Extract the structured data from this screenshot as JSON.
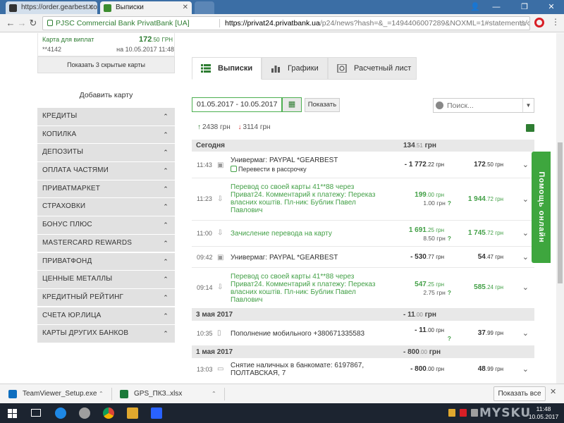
{
  "browser": {
    "tabs": [
      {
        "title": "https://order.gearbest.co"
      },
      {
        "title": "Выписки"
      }
    ],
    "site_identity": "PJSC Commercial Bank PrivatBank [UA]",
    "url_host": "https://privat24.privatbank.ua",
    "url_rest": "/p24/news?hash=&_=1494406007289&NOXML=1#statements/cards/41494"
  },
  "sidebar": {
    "card": {
      "label": "Карта для виплат",
      "amount_main": "172",
      "amount_cents": ".50",
      "currency": "ГРН",
      "number": "**4142",
      "date": "на 10.05.2017 11:48"
    },
    "show_hidden": "Показать 3 скрытые карты",
    "add_card": "Добавить карту",
    "items": [
      {
        "label": "КРЕДИТЫ"
      },
      {
        "label": "КОПИЛКА"
      },
      {
        "label": "ДЕПОЗИТЫ"
      },
      {
        "label": "ОПЛАТА ЧАСТЯМИ"
      },
      {
        "label": "ПРИВАТМАРКЕТ"
      },
      {
        "label": "СТРАХОВКИ"
      },
      {
        "label": "БОНУС ПЛЮС"
      },
      {
        "label": "MASTERCARD REWARDS"
      },
      {
        "label": "ПРИВАТФОНД"
      },
      {
        "label": "ЦЕННЫЕ МЕТАЛЛЫ"
      },
      {
        "label": "КРЕДИТНЫЙ РЕЙТИНГ"
      },
      {
        "label": "СЧЕТА ЮР.ЛИЦА"
      },
      {
        "label": "КАРТЫ ДРУГИХ БАНКОВ"
      }
    ]
  },
  "main": {
    "tabs": [
      {
        "label": "Выписки"
      },
      {
        "label": "Графики"
      },
      {
        "label": "Расчетный лист"
      }
    ],
    "date_range": "01.05.2017 - 10.05.2017",
    "show_button": "Показать",
    "search_placeholder": "Поиск...",
    "income": "2438 грн",
    "expense": "3114 грн",
    "groups": [
      {
        "title": "Сегодня",
        "sum_main": "134",
        "sum_cents": ".51",
        "sum_currency": "грн",
        "rows": [
          {
            "time": "11:43",
            "icon": "shop-icon",
            "desc": "Универмаг: PAYPAL *GEARBEST",
            "desc_green": false,
            "sub": "Перевести в рассрочку",
            "amount_main": "- 1 772",
            "amount_cents": ".22 грн",
            "amount_green": false,
            "fee": "",
            "balance_main": "172",
            "balance_cents": ".50 грн",
            "balance_green": false
          },
          {
            "time": "11:23",
            "icon": "transfer-icon",
            "desc": "Перевод со своей карты 41**88 через Приват24. Комментарий к платежу: Переказ власних коштів. Пл-ник: Бублик Павел Павлович",
            "desc_green": true,
            "sub": "",
            "amount_main": "199",
            "amount_cents": ".00 грн",
            "amount_green": true,
            "fee": "1.00 грн",
            "balance_main": "1 944",
            "balance_cents": ".72 грн",
            "balance_green": true
          },
          {
            "time": "11:00",
            "icon": "download-icon",
            "desc": "Зачисление перевода на карту",
            "desc_green": true,
            "sub": "",
            "amount_main": "1 691",
            "amount_cents": ".25 грн",
            "amount_green": true,
            "fee": "8.50 грн",
            "balance_main": "1 745",
            "balance_cents": ".72 грн",
            "balance_green": true
          },
          {
            "time": "09:42",
            "icon": "shop-icon",
            "desc": "Универмаг: PAYPAL *GEARBEST",
            "desc_green": false,
            "sub": "",
            "amount_main": "- 530",
            "amount_cents": ".77 грн",
            "amount_green": false,
            "fee": "",
            "balance_main": "54",
            "balance_cents": ".47 грн",
            "balance_green": false
          },
          {
            "time": "09:14",
            "icon": "transfer-icon",
            "desc": "Перевод со своей карты 41**88 через Приват24. Комментарий к платежу: Переказ власних коштів. Пл-ник: Бублик Павел Павлович",
            "desc_green": true,
            "sub": "",
            "amount_main": "547",
            "amount_cents": ".25 грн",
            "amount_green": true,
            "fee": "2.75 грн",
            "balance_main": "585",
            "balance_cents": ".24 грн",
            "balance_green": true
          }
        ]
      },
      {
        "title": "3 мая 2017",
        "sum_main": "- 11",
        "sum_cents": ".00",
        "sum_currency": "грн",
        "rows": [
          {
            "time": "10:35",
            "icon": "phone-icon",
            "desc": "Пополнение мобильного +380671335583",
            "desc_green": false,
            "sub": "",
            "amount_main": "- 11",
            "amount_cents": ".00 грн",
            "amount_green": false,
            "fee": "",
            "balance_main": "37",
            "balance_cents": ".99 грн",
            "balance_green": false
          }
        ]
      },
      {
        "title": "1 мая 2017",
        "sum_main": "- 800",
        "sum_cents": ".00",
        "sum_currency": "грн",
        "rows": [
          {
            "time": "13:03",
            "icon": "atm-icon",
            "desc": "Снятие наличных в банкомате: 6197867, ПОЛТАВСКАЯ, 7",
            "desc_green": false,
            "sub": "",
            "amount_main": "- 800",
            "amount_cents": ".00 грн",
            "amount_green": false,
            "fee": "",
            "balance_main": "48",
            "balance_cents": ".99 грн",
            "balance_green": false
          }
        ]
      }
    ],
    "help_tab": "Помощь онлайн"
  },
  "downloads": {
    "items": [
      {
        "name": "TeamViewer_Setup.exe"
      },
      {
        "name": "GPS_ПКЗ..xlsx"
      }
    ],
    "show_all": "Показать все"
  },
  "taskbar": {
    "time": "11:48",
    "date": "10.05.2017",
    "watermark": "MYSKU"
  },
  "colors": {
    "accent_green": "#43a047",
    "brand_green": "#2e7d32",
    "help_tab": "#3ea63e",
    "chrome_blue": "#3b6ea5"
  }
}
